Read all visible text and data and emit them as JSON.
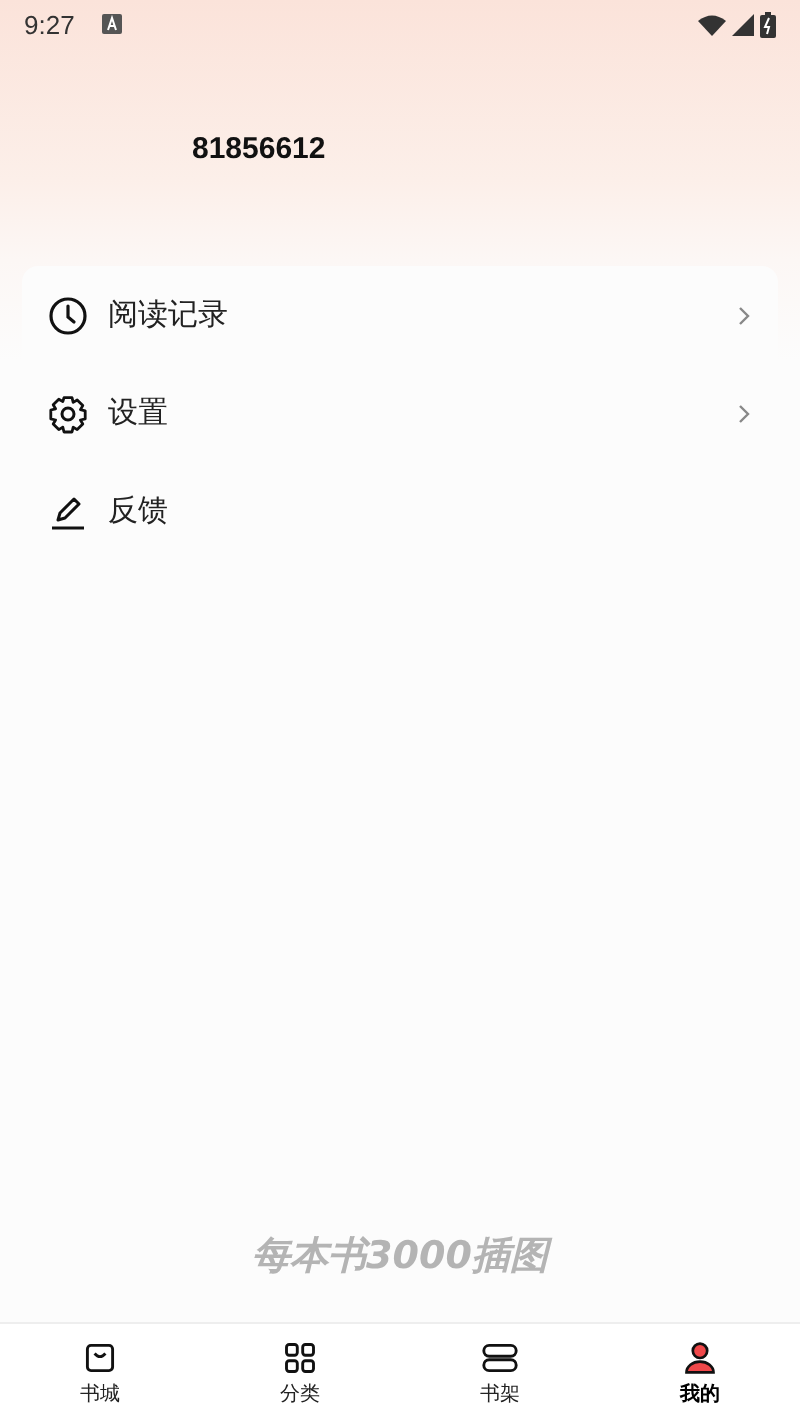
{
  "status_bar": {
    "time": "9:27"
  },
  "profile": {
    "user_id": "81856612"
  },
  "menu": [
    {
      "kind": "clock",
      "label": "阅读记录",
      "has_arrow": true
    },
    {
      "kind": "gear",
      "label": "设置",
      "has_arrow": true
    },
    {
      "kind": "pen",
      "label": "反馈",
      "has_arrow": false
    }
  ],
  "slogan": "每本书3000插图",
  "bottom_nav": [
    {
      "kind": "bag",
      "label": "书城",
      "selected": false
    },
    {
      "kind": "grid",
      "label": "分类",
      "selected": false
    },
    {
      "kind": "shelf",
      "label": "书架",
      "selected": false
    },
    {
      "kind": "person",
      "label": "我的",
      "selected": true
    }
  ]
}
